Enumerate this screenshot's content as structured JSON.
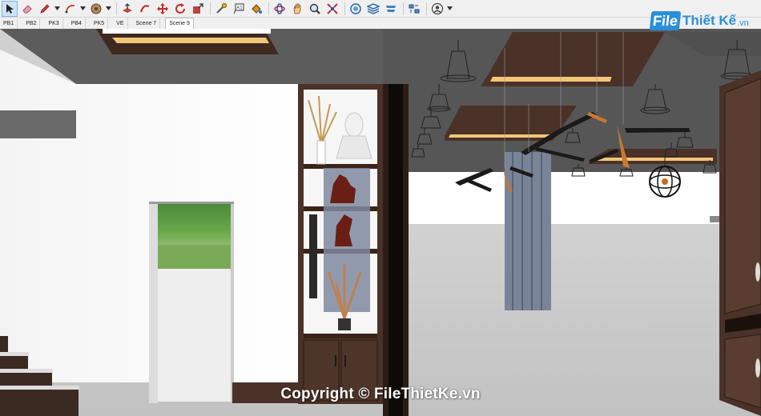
{
  "toolbar": {
    "tools": [
      "select-icon",
      "eraser-icon",
      "pencil-icon",
      "arc-icon",
      "circle-icon",
      "push-pull-icon",
      "follow-me-icon",
      "move-icon",
      "rotate-icon",
      "scale-icon",
      "tape-measure-icon",
      "text-label-icon",
      "paint-bucket-icon",
      "orbit-icon",
      "pan-icon",
      "zoom-icon",
      "zoom-extents-icon",
      "sandbox-icon",
      "layers-icon",
      "styles-icon",
      "components-icon",
      "account-icon"
    ],
    "selected_tool": "select-icon"
  },
  "scenes": {
    "tabs": [
      "PB1",
      "PB2",
      "PK3",
      "PB4",
      "PK5",
      "VE",
      "Scene 7",
      "Scene 9"
    ],
    "active": "Scene 9"
  },
  "watermark": {
    "text": "Copyright © FileThietKe.vn"
  },
  "logo": {
    "box": "File",
    "name": "Thiết Kế",
    "tld": ".vn"
  },
  "colors": {
    "accent": "#2a8fd6",
    "wood": "#4a3228",
    "ceiling": "#5a5a5a",
    "light_strip": "#f2c679"
  }
}
